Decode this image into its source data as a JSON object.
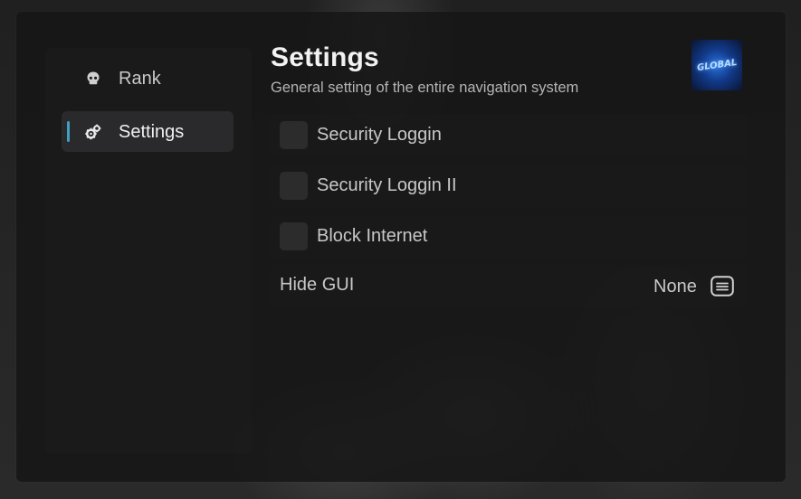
{
  "sidebar": {
    "items": [
      {
        "label": "Rank",
        "icon": "skull-icon",
        "active": false
      },
      {
        "label": "Settings",
        "icon": "gears-icon",
        "active": true
      }
    ]
  },
  "header": {
    "title": "Settings",
    "subtitle": "General setting of the entire navigation system",
    "avatar_text": "GLOBAL"
  },
  "options": [
    {
      "label": "Security Loggin",
      "checked": false
    },
    {
      "label": "Security Loggin II",
      "checked": false
    },
    {
      "label": "Block Internet",
      "checked": false
    }
  ],
  "keybind": {
    "label": "Hide GUI",
    "value": "None",
    "icon": "keyboard-icon"
  },
  "colors": {
    "accent": "#3fa0c6",
    "panel": "#161616",
    "text": "#c8c8c8"
  }
}
